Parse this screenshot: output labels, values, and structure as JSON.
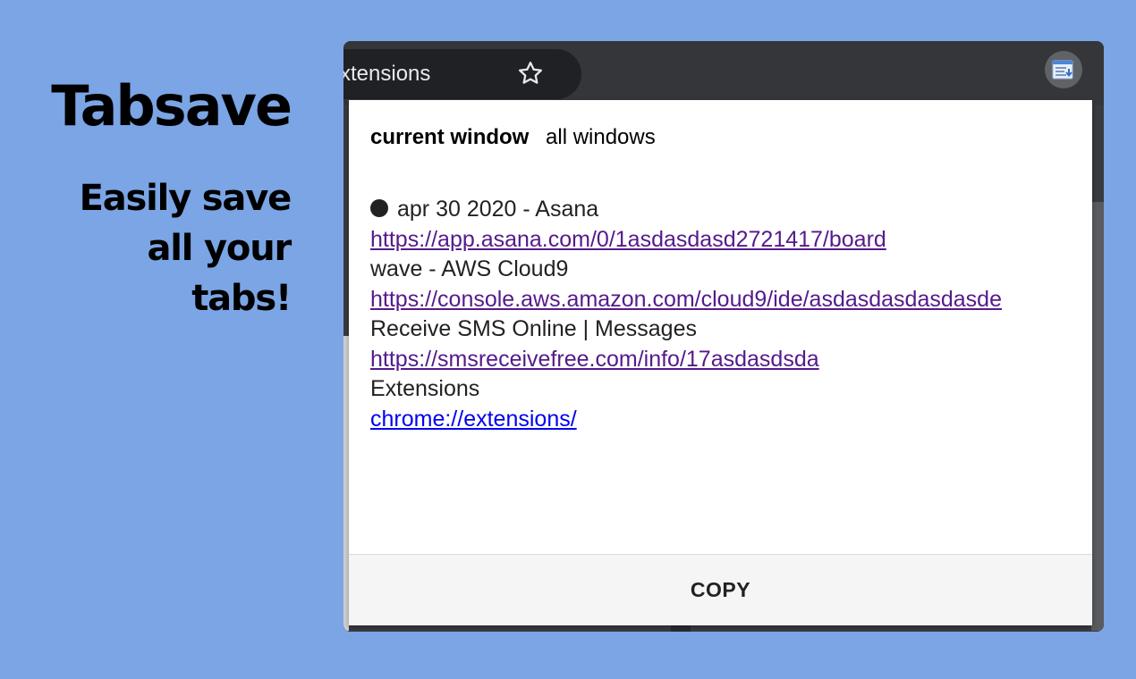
{
  "promo": {
    "title": "Tabsave",
    "tagline_line1": "Easily save",
    "tagline_line2": "all your",
    "tagline_line3": "tabs!"
  },
  "browser": {
    "tab_title": "xtensions",
    "star_icon": "star-outline-icon",
    "extension_icon": "tabsave-extension-icon"
  },
  "popup": {
    "mode_current": "current window",
    "mode_all": "all windows",
    "tabs": [
      {
        "title": "apr 30 2020 - Asana",
        "url": "https://app.asana.com/0/1asdasdasd2721417/board",
        "visited": true
      },
      {
        "title": "wave - AWS Cloud9",
        "url": "https://console.aws.amazon.com/cloud9/ide/asdasdasdasdasde",
        "visited": true
      },
      {
        "title": "Receive SMS Online | Messages",
        "url": "https://smsreceivefree.com/info/17asdasdsda",
        "visited": true
      },
      {
        "title": "Extensions",
        "url": "chrome://extensions/",
        "visited": false
      }
    ],
    "copy_label": "COPY"
  },
  "colors": {
    "background": "#7BA5E4",
    "browser_chrome": "#35363A",
    "visited_link": "#551A8B",
    "unvisited_link": "#0000EE"
  }
}
